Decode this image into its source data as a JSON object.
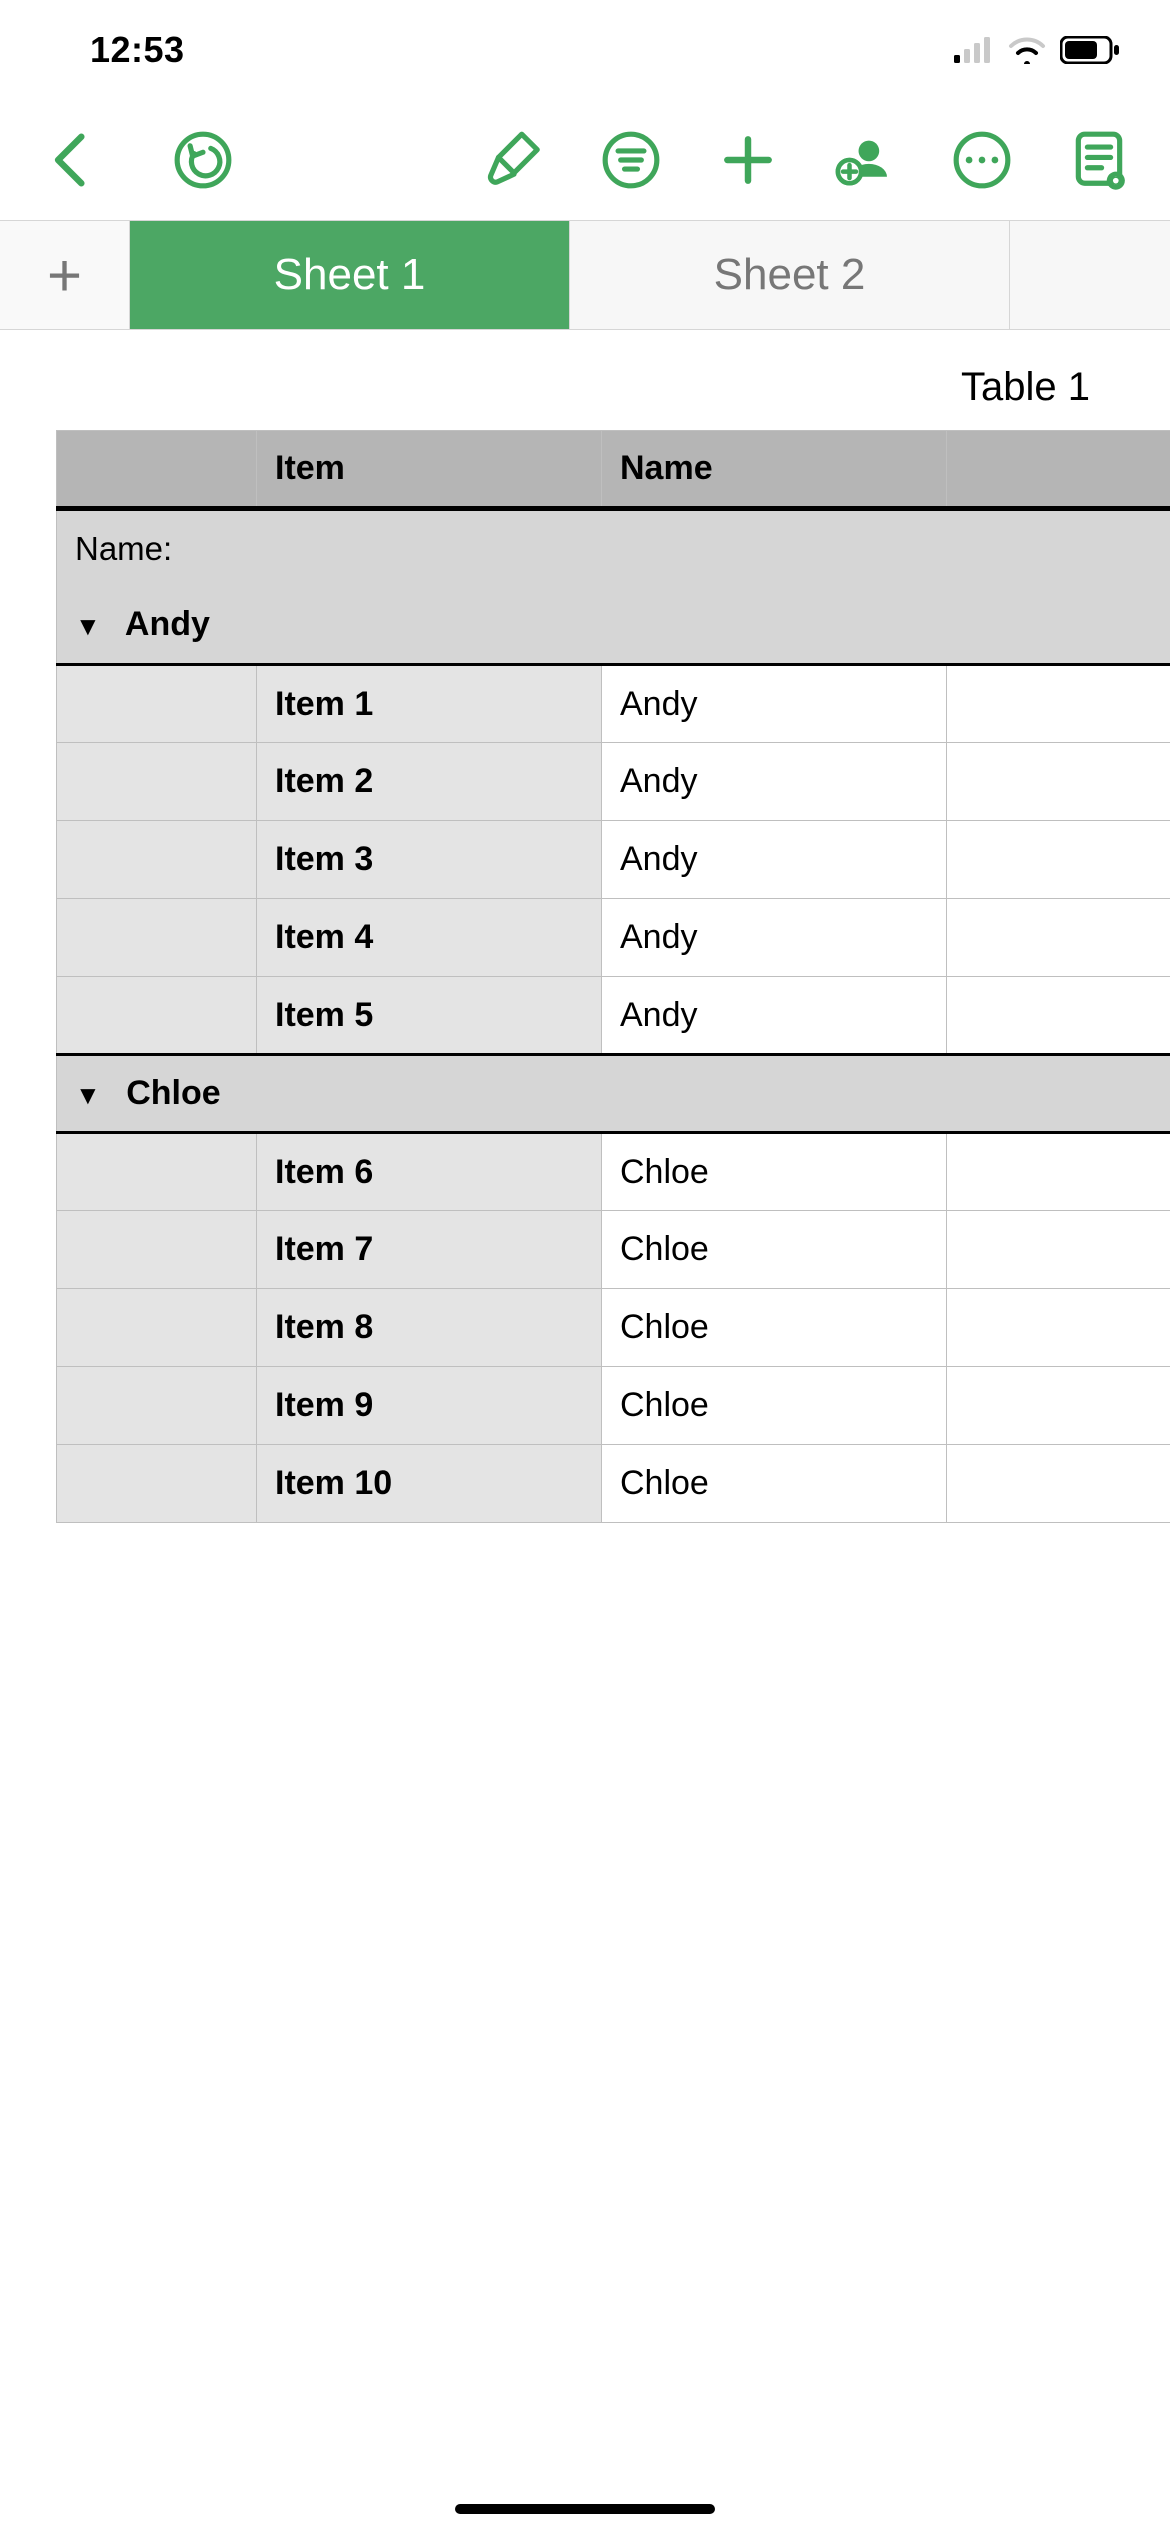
{
  "status": {
    "time": "12:53"
  },
  "sheet_tabs": {
    "add_label": "+",
    "tabs": [
      {
        "label": "Sheet 1",
        "active": true
      },
      {
        "label": "Sheet 2",
        "active": false
      }
    ]
  },
  "table": {
    "title": "Table 1",
    "columns": [
      "",
      "Item",
      "Name",
      ""
    ],
    "category_field_label": "Name:",
    "groups": [
      {
        "name": "Andy",
        "rows": [
          {
            "item": "Item 1",
            "name": "Andy"
          },
          {
            "item": "Item 2",
            "name": "Andy"
          },
          {
            "item": "Item 3",
            "name": "Andy"
          },
          {
            "item": "Item 4",
            "name": "Andy"
          },
          {
            "item": "Item 5",
            "name": "Andy"
          }
        ]
      },
      {
        "name": "Chloe",
        "rows": [
          {
            "item": "Item 6",
            "name": "Chloe"
          },
          {
            "item": "Item 7",
            "name": "Chloe"
          },
          {
            "item": "Item 8",
            "name": "Chloe"
          },
          {
            "item": "Item 9",
            "name": "Chloe"
          },
          {
            "item": "Item 10",
            "name": "Chloe"
          }
        ]
      }
    ]
  },
  "colors": {
    "accent": "#4ca764"
  }
}
